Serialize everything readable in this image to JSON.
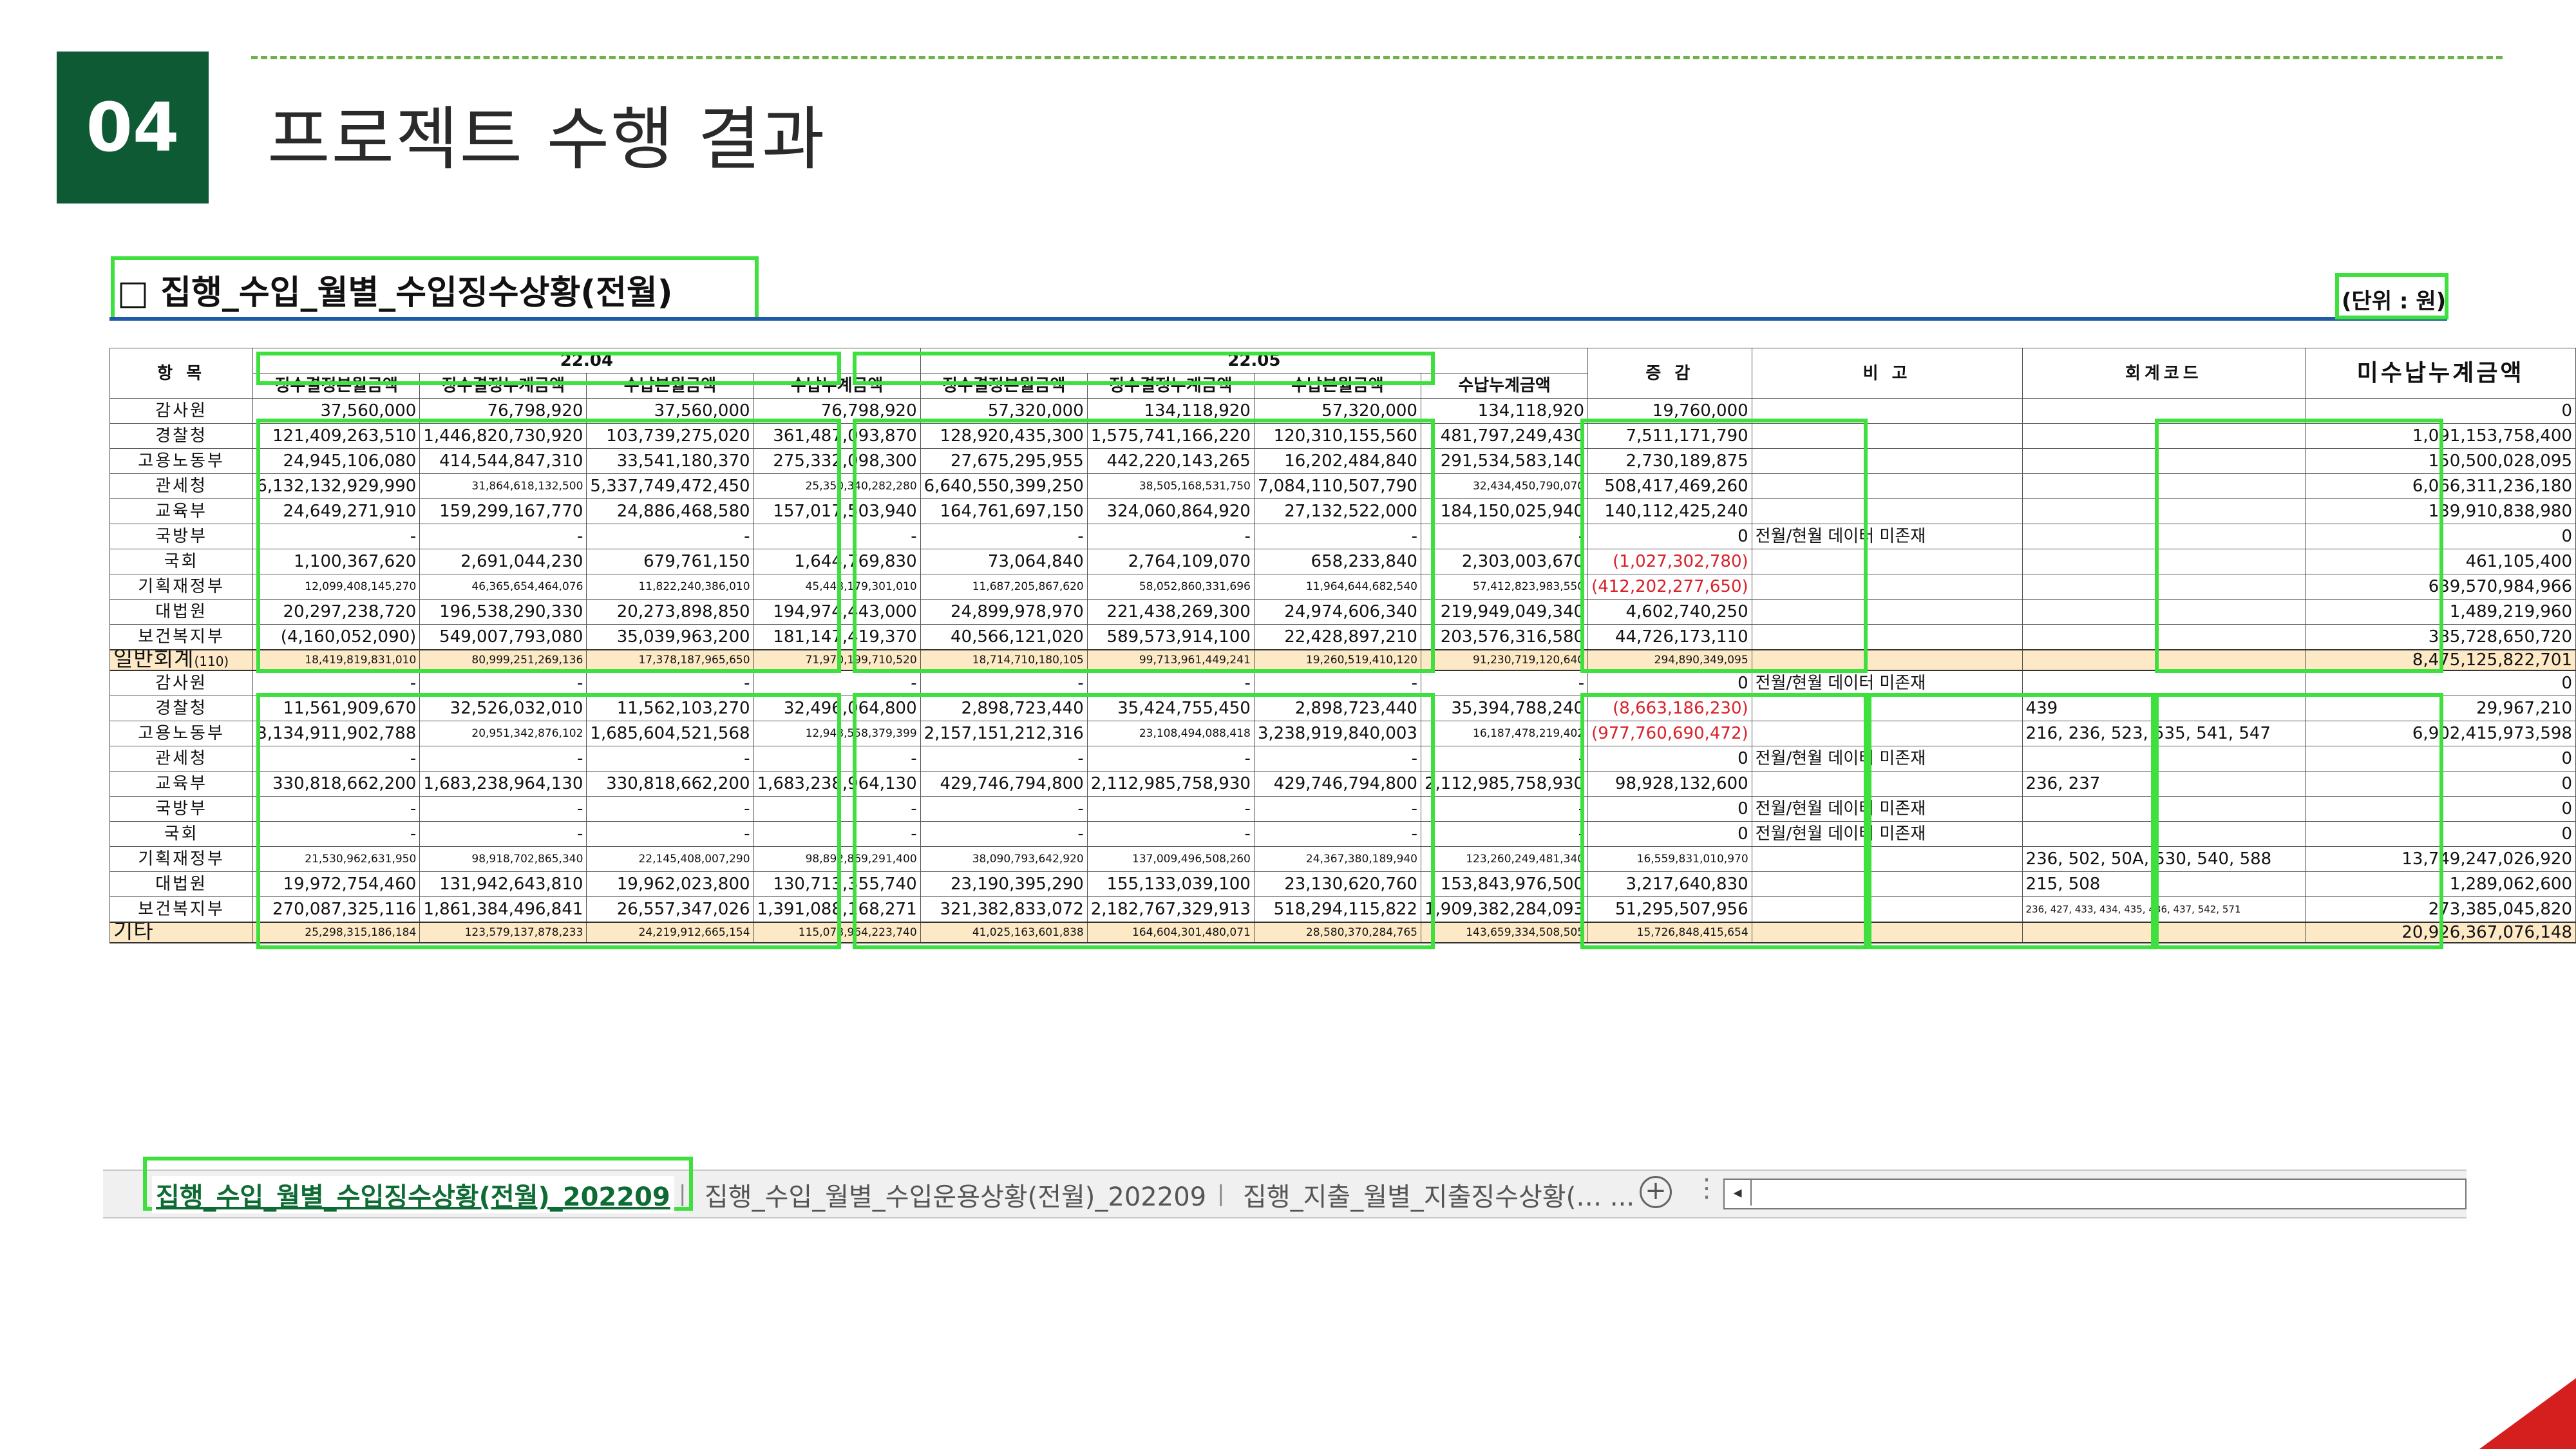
{
  "slide": {
    "number": "04",
    "title": "프로젝트 수행 결과"
  },
  "sheet": {
    "title": "□ 집행_수입_월별_수입징수상황(전월)",
    "unit": "(단위 : 원)"
  },
  "headers": {
    "item": "항 목",
    "month1": "22.04",
    "month2": "22.05",
    "sub": [
      "징수결정본월금액",
      "징수결정누계금액",
      "수납본월금액",
      "수납누계금액"
    ],
    "change": "증 감",
    "memo": "비 고",
    "code": "회계코드",
    "unpaid": "미수납누계금액"
  },
  "sections": [
    {
      "rows": [
        {
          "item": "감사원",
          "v": [
            "37,560,000",
            "76,798,920",
            "37,560,000",
            "76,798,920",
            "57,320,000",
            "134,118,920",
            "57,320,000",
            "134,118,920"
          ],
          "change": "19,760,000",
          "neg": false,
          "memo": "",
          "code": "",
          "unpaid": "0"
        },
        {
          "item": "경찰청",
          "v": [
            "121,409,263,510",
            "1,446,820,730,920",
            "103,739,275,020",
            "361,487,093,870",
            "128,920,435,300",
            "1,575,741,166,220",
            "120,310,155,560",
            "481,797,249,430"
          ],
          "change": "7,511,171,790",
          "neg": false,
          "memo": "",
          "code": "",
          "unpaid": "1,091,153,758,400"
        },
        {
          "item": "고용노동부",
          "v": [
            "24,945,106,080",
            "414,544,847,310",
            "33,541,180,370",
            "275,332,098,300",
            "27,675,295,955",
            "442,220,143,265",
            "16,202,484,840",
            "291,534,583,140"
          ],
          "change": "2,730,189,875",
          "neg": false,
          "memo": "",
          "code": "",
          "unpaid": "150,500,028,095"
        },
        {
          "item": "관세청",
          "v": [
            "6,132,132,929,990",
            "31,864,618,132,500",
            "5,337,749,472,450",
            "25,350,340,282,280",
            "6,640,550,399,250",
            "38,505,168,531,750",
            "7,084,110,507,790",
            "32,434,450,790,070"
          ],
          "change": "508,417,469,260",
          "neg": false,
          "memo": "",
          "code": "",
          "unpaid": "6,066,311,236,180"
        },
        {
          "item": "교육부",
          "v": [
            "24,649,271,910",
            "159,299,167,770",
            "24,886,468,580",
            "157,017,503,940",
            "164,761,697,150",
            "324,060,864,920",
            "27,132,522,000",
            "184,150,025,940"
          ],
          "change": "140,112,425,240",
          "neg": false,
          "memo": "",
          "code": "",
          "unpaid": "139,910,838,980"
        },
        {
          "item": "국방부",
          "v": [
            "-",
            "-",
            "-",
            "-",
            "-",
            "-",
            "-",
            "-"
          ],
          "change": "0",
          "neg": false,
          "memo": "전월/현월 데이터 미존재",
          "code": "",
          "unpaid": "0"
        },
        {
          "item": "국회",
          "v": [
            "1,100,367,620",
            "2,691,044,230",
            "679,761,150",
            "1,644,769,830",
            "73,064,840",
            "2,764,109,070",
            "658,233,840",
            "2,303,003,670"
          ],
          "change": "(1,027,302,780)",
          "neg": true,
          "memo": "",
          "code": "",
          "unpaid": "461,105,400"
        },
        {
          "item": "기획재정부",
          "v": [
            "12,099,408,145,270",
            "46,365,654,464,076",
            "11,822,240,386,010",
            "45,448,179,301,010",
            "11,687,205,867,620",
            "58,052,860,331,696",
            "11,964,644,682,540",
            "57,412,823,983,550"
          ],
          "change": "(412,202,277,650)",
          "neg": true,
          "memo": "",
          "code": "",
          "unpaid": "639,570,984,966"
        },
        {
          "item": "대법원",
          "v": [
            "20,297,238,720",
            "196,538,290,330",
            "20,273,898,850",
            "194,974,443,000",
            "24,899,978,970",
            "221,438,269,300",
            "24,974,606,340",
            "219,949,049,340"
          ],
          "change": "4,602,740,250",
          "neg": false,
          "memo": "",
          "code": "",
          "unpaid": "1,489,219,960"
        },
        {
          "item": "보건복지부",
          "v": [
            "(4,160,052,090)",
            "549,007,793,080",
            "35,039,963,200",
            "181,147,419,370",
            "40,566,121,020",
            "589,573,914,100",
            "22,428,897,210",
            "203,576,316,580"
          ],
          "change": "44,726,173,110",
          "neg": false,
          "memo": "",
          "code": "",
          "unpaid": "385,728,650,720"
        }
      ],
      "total": {
        "item": "일반회계",
        "suffix": "(110)",
        "v": [
          "18,419,819,831,010",
          "80,999,251,269,136",
          "17,378,187,965,650",
          "71,970,199,710,520",
          "18,714,710,180,105",
          "99,713,961,449,241",
          "19,260,519,410,120",
          "91,230,719,120,640"
        ],
        "change": "294,890,349,095",
        "unpaid": "8,475,125,822,701"
      }
    },
    {
      "rows": [
        {
          "item": "감사원",
          "v": [
            "-",
            "-",
            "-",
            "-",
            "-",
            "-",
            "-",
            "-"
          ],
          "change": "0",
          "neg": false,
          "memo": "전월/현월 데이터 미존재",
          "code": "",
          "unpaid": "0"
        },
        {
          "item": "경찰청",
          "v": [
            "11,561,909,670",
            "32,526,032,010",
            "11,562,103,270",
            "32,496,064,800",
            "2,898,723,440",
            "35,424,755,450",
            "2,898,723,440",
            "35,394,788,240"
          ],
          "change": "(8,663,186,230)",
          "neg": true,
          "memo": "",
          "code": "439",
          "unpaid": "29,967,210"
        },
        {
          "item": "고용노동부",
          "v": [
            "3,134,911,902,788",
            "20,951,342,876,102",
            "1,685,604,521,568",
            "12,948,558,379,399",
            "2,157,151,212,316",
            "23,108,494,088,418",
            "3,238,919,840,003",
            "16,187,478,219,402"
          ],
          "change": "(977,760,690,472)",
          "neg": true,
          "memo": "",
          "code": "216, 236, 523, 535, 541, 547",
          "unpaid": "6,902,415,973,598"
        },
        {
          "item": "관세청",
          "v": [
            "-",
            "-",
            "-",
            "-",
            "-",
            "-",
            "-",
            "-"
          ],
          "change": "0",
          "neg": false,
          "memo": "전월/현월 데이터 미존재",
          "code": "",
          "unpaid": "0"
        },
        {
          "item": "교육부",
          "v": [
            "330,818,662,200",
            "1,683,238,964,130",
            "330,818,662,200",
            "1,683,238,964,130",
            "429,746,794,800",
            "2,112,985,758,930",
            "429,746,794,800",
            "2,112,985,758,930"
          ],
          "change": "98,928,132,600",
          "neg": false,
          "memo": "",
          "code": "236, 237",
          "unpaid": "0"
        },
        {
          "item": "국방부",
          "v": [
            "-",
            "-",
            "-",
            "-",
            "-",
            "-",
            "-",
            "-"
          ],
          "change": "0",
          "neg": false,
          "memo": "전월/현월 데이터 미존재",
          "code": "",
          "unpaid": "0"
        },
        {
          "item": "국회",
          "v": [
            "-",
            "-",
            "-",
            "-",
            "-",
            "-",
            "-",
            "-"
          ],
          "change": "0",
          "neg": false,
          "memo": "전월/현월 데이터 미존재",
          "code": "",
          "unpaid": "0"
        },
        {
          "item": "기획재정부",
          "v": [
            "21,530,962,631,950",
            "98,918,702,865,340",
            "22,145,408,007,290",
            "98,892,869,291,400",
            "38,090,793,642,920",
            "137,009,496,508,260",
            "24,367,380,189,940",
            "123,260,249,481,340"
          ],
          "change": "16,559,831,010,970",
          "neg": false,
          "memo": "",
          "code": "236, 502, 50A, 530, 540, 588",
          "unpaid": "13,749,247,026,920"
        },
        {
          "item": "대법원",
          "v": [
            "19,972,754,460",
            "131,942,643,810",
            "19,962,023,800",
            "130,713,355,740",
            "23,190,395,290",
            "155,133,039,100",
            "23,130,620,760",
            "153,843,976,500"
          ],
          "change": "3,217,640,830",
          "neg": false,
          "memo": "",
          "code": "215, 508",
          "unpaid": "1,289,062,600"
        },
        {
          "item": "보건복지부",
          "v": [
            "270,087,325,116",
            "1,861,384,496,841",
            "26,557,347,026",
            "1,391,088,168,271",
            "321,382,833,072",
            "2,182,767,329,913",
            "518,294,115,822",
            "1,909,382,284,093"
          ],
          "change": "51,295,507,956",
          "neg": false,
          "memo": "",
          "code": "236, 427, 433, 434, 435, 436, 437, 542, 571",
          "unpaid": "273,385,045,820"
        }
      ],
      "total": {
        "item": "기타",
        "suffix": "",
        "v": [
          "25,298,315,186,184",
          "123,579,137,878,233",
          "24,219,912,665,154",
          "115,078,964,223,740",
          "41,025,163,601,838",
          "164,604,301,480,071",
          "28,580,370,284,765",
          "143,659,334,508,505"
        ],
        "change": "15,726,848,415,654",
        "unpaid": "20,926,367,076,148"
      }
    }
  ],
  "tabs": {
    "active": "집행_수입_월별_수입징수상황(전월)_202209",
    "second": "집행_수입_월별_수입운용상황(전월)_202209",
    "third": "집행_지출_월별_지출징수상황(… ...",
    "separator": "|",
    "add": "+",
    "more": "⋮",
    "scroll_left": "◂"
  },
  "colors": {
    "accent_green": "#0e5a35",
    "highlight": "#3ee03e",
    "negative": "#d9212a",
    "total_row": "#fde9c6",
    "rule_blue": "#1f5aa8"
  }
}
